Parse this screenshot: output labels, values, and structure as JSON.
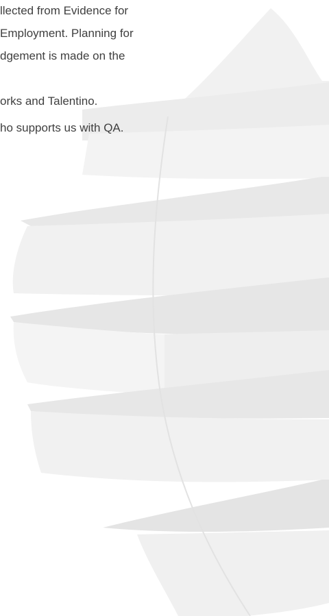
{
  "document": {
    "paragraph_1": [
      "llected from Evidence for",
      "Employment. Planning for",
      "dgement is made on the"
    ],
    "line_2": "orks and Talentino.",
    "line_3": "ho supports us with QA."
  },
  "watermark": {
    "icon": "twisted-ribbon-watermark-icon",
    "color_light": "#f2f2f2",
    "color_mid": "#e9e9e9",
    "color_dark": "#e3e3e3"
  }
}
